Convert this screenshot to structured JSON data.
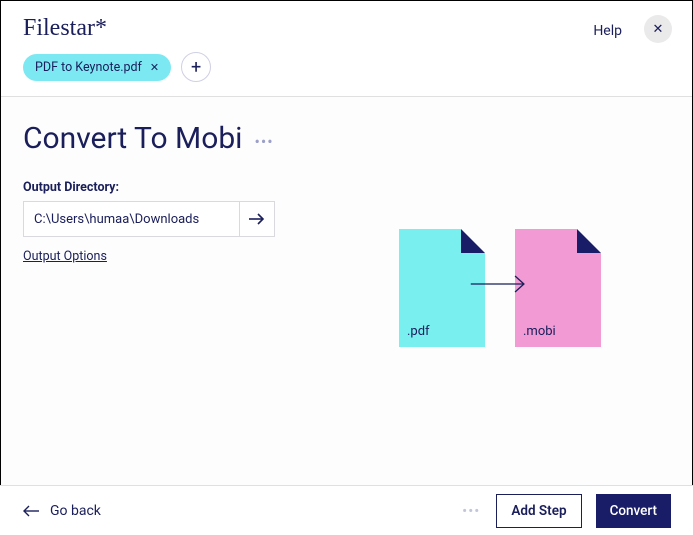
{
  "header": {
    "logo": "Filestar*",
    "help_label": "Help"
  },
  "file_chip": {
    "label": "PDF to Keynote.pdf"
  },
  "main": {
    "title": "Convert To Mobi",
    "output_dir_label": "Output Directory:",
    "output_dir_value": "C:\\Users\\humaa\\Downloads",
    "output_options_label": "Output Options"
  },
  "diagram": {
    "src_ext": ".pdf",
    "dst_ext": ".mobi"
  },
  "footer": {
    "go_back": "Go back",
    "add_step": "Add Step",
    "convert": "Convert"
  }
}
